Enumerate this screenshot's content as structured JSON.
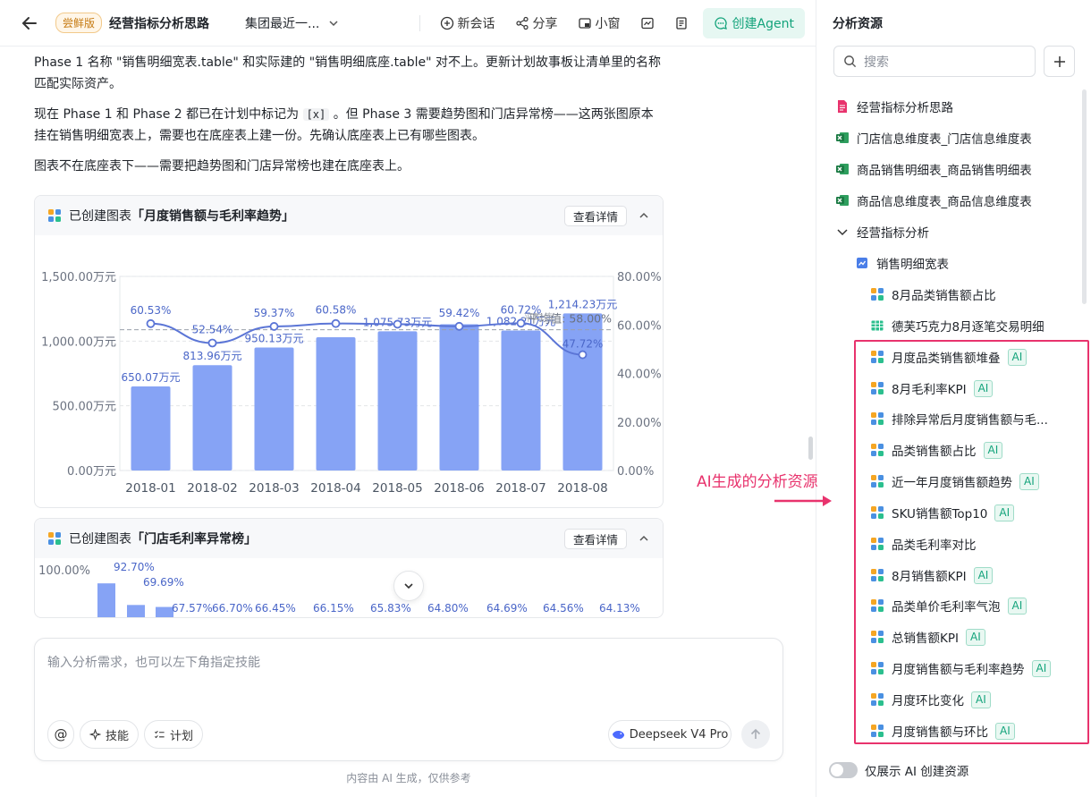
{
  "header": {
    "trial_badge": "尝鲜版",
    "title": "经营指标分析思路",
    "scope_label": "集团最近一...",
    "new_chat": "新会话",
    "share": "分享",
    "mini_window": "小窗",
    "create_agent": "创建Agent"
  },
  "messages": {
    "p1": "Phase 1 名称 \"销售明细宽表.table\" 和实际建的 \"销售明细底座.table\" 对不上。更新计划故事板让清单里的名称匹配实际资产。",
    "p2_a": "现在 Phase 1 和 Phase 2 都已在计划中标记为 ",
    "p2_code": "[x]",
    "p2_b": " 。但 Phase 3 需要趋势图和门店异常榜——这两张图原本挂在销售明细宽表上，需要也在底座表上建一份。先确认底座表上已有哪些图表。",
    "p3": "图表不在底座表下——需要把趋势图和门店异常榜也建在底座表上。"
  },
  "card1": {
    "prefix": "已创建图表",
    "name": "「月度销售额与毛利率趋势」",
    "detail_btn": "查看详情"
  },
  "card2": {
    "prefix": "已创建图表",
    "name": "「门店毛利率异常榜」",
    "detail_btn": "查看详情"
  },
  "chart_data": [
    {
      "type": "bar",
      "title": "月度销售额与毛利率趋势",
      "categories": [
        "2018-01",
        "2018-02",
        "2018-03",
        "2018-04",
        "2018-05",
        "2018-06",
        "2018-07",
        "2018-08"
      ],
      "series": [
        {
          "values": [
            650.07,
            813.96,
            950.13,
            1030,
            1075.73,
            1130,
            1082.21,
            1214.23
          ],
          "labels": [
            "650.07万元",
            "813.96万元",
            "950.13万元",
            "",
            "1,075.73万元",
            "",
            "1,082.21万元",
            "1,214.23万元"
          ],
          "axis": "left",
          "color": "#86a3f5"
        },
        {
          "values": [
            60.53,
            52.54,
            59.37,
            60.58,
            60.3,
            59.42,
            60.72,
            47.72
          ],
          "labels": [
            "60.53%",
            "52.54%",
            "59.37%",
            "60.58%",
            "",
            "59.42%",
            "60.72%",
            "47.72%"
          ],
          "axis": "right",
          "type": "line",
          "color": "#5b75d6"
        }
      ],
      "yticks_left": [
        "1,500.00万元",
        "1,000.00万元",
        "500.00万元",
        "0.00万元"
      ],
      "yticks_right": [
        "80.00%",
        "60.00%",
        "40.00%",
        "20.00%",
        "0.00%"
      ],
      "ylim_left": [
        0,
        1500
      ],
      "ylim_right": [
        0,
        80
      ],
      "reference_line": {
        "value": 58.0,
        "label": "平均值: 58.00%"
      },
      "reference_line_2": {
        "label": "平均值:"
      },
      "grid": true
    },
    {
      "type": "bar",
      "title": "门店毛利率异常榜",
      "ytick_top": "100.00%",
      "values": [
        92.7,
        69.69,
        67.57,
        66.7,
        66.45,
        66.15,
        65.83,
        64.8,
        64.69,
        64.56,
        64.13
      ],
      "labels": [
        "92.70%",
        "69.69%",
        "67.57%",
        "66.70%",
        "66.45%",
        "66.15%",
        "65.83%",
        "64.80%",
        "64.69%",
        "64.56%",
        "64.13%"
      ],
      "color": "#86a3f5"
    }
  ],
  "composer": {
    "placeholder": "输入分析需求，也可以左下角指定技能",
    "skill": "技能",
    "plan": "计划",
    "model": "Deepseek V4 Pro"
  },
  "footnote": "内容由 AI 生成，仅供参考",
  "resources": {
    "title": "分析资源",
    "search_placeholder": "搜索",
    "ai_tag": "AI",
    "items": [
      {
        "label": "经营指标分析思路",
        "icon": "doc-icon",
        "ai": false
      },
      {
        "label": "门店信息维度表_门店信息维度表",
        "icon": "excel-icon",
        "ai": false
      },
      {
        "label": "商品销售明细表_商品销售明细表",
        "icon": "excel-icon",
        "ai": false
      },
      {
        "label": "商品信息维度表_商品信息维度表",
        "icon": "excel-icon",
        "ai": false
      },
      {
        "label": "经营指标分析",
        "icon": "chevron-down-icon",
        "ai": false
      },
      {
        "label": "销售明细宽表",
        "icon": "table-chart-icon",
        "ai": false
      },
      {
        "label": "8月品类销售额占比",
        "icon": "chart-icon",
        "ai": false
      },
      {
        "label": "德芙巧克力8月逐笔交易明细",
        "icon": "grid-icon",
        "ai": false
      },
      {
        "label": "月度品类销售额堆叠",
        "icon": "chart-icon",
        "ai": true
      },
      {
        "label": "8月毛利率KPI",
        "icon": "chart-icon",
        "ai": true
      },
      {
        "label": "排除异常后月度销售额与毛...",
        "icon": "chart-icon",
        "ai": false
      },
      {
        "label": "品类销售额占比",
        "icon": "chart-icon",
        "ai": true
      },
      {
        "label": "近一年月度销售额趋势",
        "icon": "chart-icon",
        "ai": true
      },
      {
        "label": "SKU销售额Top10",
        "icon": "chart-icon",
        "ai": true
      },
      {
        "label": "品类毛利率对比",
        "icon": "chart-icon",
        "ai": false
      },
      {
        "label": "8月销售额KPI",
        "icon": "chart-icon",
        "ai": true
      },
      {
        "label": "品类单价毛利率气泡",
        "icon": "chart-icon",
        "ai": true
      },
      {
        "label": "总销售额KPI",
        "icon": "chart-icon",
        "ai": true
      },
      {
        "label": "月度销售额与毛利率趋势",
        "icon": "chart-icon",
        "ai": true
      },
      {
        "label": "月度环比变化",
        "icon": "chart-icon",
        "ai": true
      },
      {
        "label": "月度销售额与环比",
        "icon": "chart-icon",
        "ai": true
      }
    ],
    "annotation": "AI生成的分析资源",
    "toggle_label": "仅展示 AI 创建资源"
  },
  "colors": {
    "accent": "#13a37b",
    "bar": "#86a3f5",
    "line": "#5b75d6",
    "highlight": "#e8336d"
  }
}
